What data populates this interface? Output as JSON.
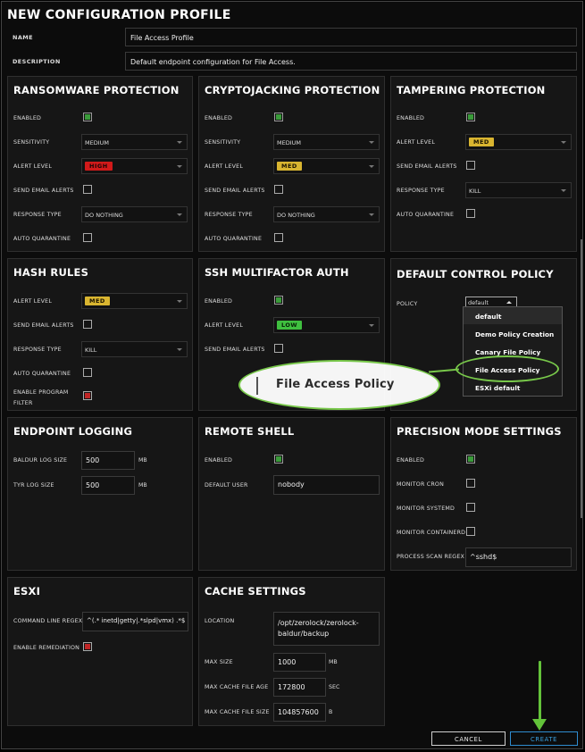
{
  "title": "NEW CONFIGURATION PROFILE",
  "name": {
    "label": "NAME",
    "value": "File Access Profile"
  },
  "description": {
    "label": "DESCRIPTION",
    "value": "Default endpoint configuration for File Access."
  },
  "ransomware": {
    "title": "RANSOMWARE PROTECTION",
    "enabled_label": "ENABLED",
    "sensitivity_label": "SENSITIVITY",
    "sensitivity": "MEDIUM",
    "alert_label": "ALERT LEVEL",
    "alert": "HIGH",
    "email_label": "SEND EMAIL ALERTS",
    "response_label": "RESPONSE TYPE",
    "response": "DO NOTHING",
    "quarantine_label": "AUTO QUARANTINE"
  },
  "crypto": {
    "title": "CRYPTOJACKING PROTECTION",
    "enabled_label": "ENABLED",
    "sensitivity_label": "SENSITIVITY",
    "sensitivity": "MEDIUM",
    "alert_label": "ALERT LEVEL",
    "alert": "MED",
    "email_label": "SEND EMAIL ALERTS",
    "response_label": "RESPONSE TYPE",
    "response": "DO NOTHING",
    "quarantine_label": "AUTO QUARANTINE"
  },
  "tamper": {
    "title": "TAMPERING PROTECTION",
    "enabled_label": "ENABLED",
    "alert_label": "ALERT LEVEL",
    "alert": "MED",
    "email_label": "SEND EMAIL ALERTS",
    "response_label": "RESPONSE TYPE",
    "response": "KILL",
    "quarantine_label": "AUTO QUARANTINE"
  },
  "hash": {
    "title": "HASH RULES",
    "alert_label": "ALERT LEVEL",
    "alert": "MED",
    "email_label": "SEND EMAIL ALERTS",
    "response_label": "RESPONSE TYPE",
    "response": "KILL",
    "quarantine_label": "AUTO QUARANTINE",
    "program_filter_label_1": "ENABLE PROGRAM",
    "program_filter_label_2": "FILTER"
  },
  "ssh": {
    "title": "SSH MULTIFACTOR AUTH",
    "enabled_label": "ENABLED",
    "alert_label": "ALERT LEVEL",
    "alert": "LOW",
    "email_label": "SEND EMAIL ALERTS"
  },
  "control": {
    "title": "DEFAULT CONTROL POLICY",
    "policy_label": "POLICY",
    "policy_value": "default",
    "options": [
      "default",
      "Demo Policy Creation",
      "Canary File Policy",
      "File Access Policy",
      "ESXi default"
    ]
  },
  "callout": {
    "text": "File Access Policy"
  },
  "logging": {
    "title": "ENDPOINT LOGGING",
    "baldur_label": "BALDUR LOG SIZE",
    "baldur": "500",
    "baldur_unit": "MB",
    "tyr_label": "TYR LOG SIZE",
    "tyr": "500",
    "tyr_unit": "MB"
  },
  "shell": {
    "title": "REMOTE SHELL",
    "enabled_label": "ENABLED",
    "user_label": "DEFAULT USER",
    "user": "nobody"
  },
  "precision": {
    "title": "PRECISION MODE SETTINGS",
    "enabled_label": "ENABLED",
    "cron_label": "MONITOR CRON",
    "systemd_label": "MONITOR SYSTEMD",
    "containerd_label": "MONITOR CONTAINERD",
    "regex_label": "PROCESS SCAN REGEX",
    "regex": "^sshd$"
  },
  "esxi": {
    "title": "ESXI",
    "cmd_label": "COMMAND LINE REGEX",
    "cmd": "^(.* inetd|getty|.*slpd|vmx) .*$",
    "remediation_label": "ENABLE REMEDIATION"
  },
  "cache": {
    "title": "CACHE SETTINGS",
    "location_label": "LOCATION",
    "location_1": "/opt/zerolock/zerolock-",
    "location_2": "baldur/backup",
    "maxsize_label": "MAX SIZE",
    "maxsize": "1000",
    "maxsize_unit": "MB",
    "maxage_label": "MAX CACHE FILE AGE",
    "maxage": "172800",
    "maxage_unit": "SEC",
    "maxfile_label": "MAX CACHE FILE SIZE",
    "maxfile": "104857600",
    "maxfile_unit": "B"
  },
  "buttons": {
    "cancel": "CANCEL",
    "create": "CREATE"
  },
  "colors": {
    "accent": "#63c33a",
    "create_text": "#3aa0e0",
    "high": "#d11a1a",
    "med": "#d9b530",
    "low": "#3fbf3f"
  }
}
